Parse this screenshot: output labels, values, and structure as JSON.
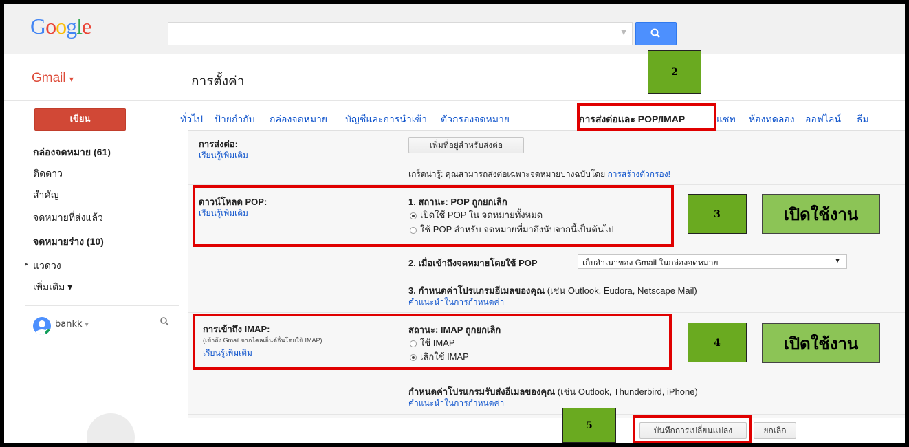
{
  "header": {
    "logo": "Google",
    "search_placeholder": "",
    "search_button_icon": "search-icon"
  },
  "app": {
    "name": "Gmail",
    "menu_caret": "▾",
    "page_title": "การตั้งค่า"
  },
  "sidebar": {
    "compose": "เขียน",
    "items": [
      {
        "label": "กล่องจดหมาย (61)",
        "bold": true
      },
      {
        "label": "ติดดาว",
        "bold": false
      },
      {
        "label": "สำคัญ",
        "bold": false
      },
      {
        "label": "จดหมายที่ส่งแล้ว",
        "bold": false
      },
      {
        "label": "จดหมายร่าง (10)",
        "bold": true
      },
      {
        "label": "แวดวง",
        "bold": false
      },
      {
        "label": "เพิ่มเติม ▾",
        "bold": false
      }
    ],
    "circles_arrow": "▸",
    "user": "bankk",
    "user_caret": "▾"
  },
  "tabs": [
    {
      "label": "ทั่วไป"
    },
    {
      "label": "ป้ายกำกับ"
    },
    {
      "label": "กล่องจดหมาย"
    },
    {
      "label": "บัญชีและการนำเข้า"
    },
    {
      "label": "ตัวกรองจดหมาย"
    },
    {
      "label": "การส่งต่อและ POP/IMAP",
      "active": true
    },
    {
      "label": "แชท"
    },
    {
      "label": "ห้องทดลอง"
    },
    {
      "label": "ออฟไลน์"
    },
    {
      "label": "ธีม"
    }
  ],
  "forwarding": {
    "label": "การส่งต่อ:",
    "learn_more": "เรียนรู้เพิ่มเติม",
    "add_button": "เพิ่มที่อยู่สำหรับส่งต่อ",
    "tip_prefix": "เกร็ดน่ารู้: คุณสามารถส่งต่อเฉพาะจดหมายบางฉบับโดย ",
    "tip_link": "การสร้างตัวกรอง!"
  },
  "pop": {
    "label": "ดาวน์โหลด POP:",
    "learn_more": "เรียนรู้เพิ่มเติม",
    "status": "1. สถานะ: POP ถูกยกเลิก",
    "option1": "เปิดใช้ POP ใน จดหมายทั้งหมด",
    "option2": "ใช้ POP สำหรับ จดหมายที่มาถึงนับจากนี้เป็นต้นไป",
    "when_access": "2. เมื่อเข้าถึงจดหมายโดยใช้ POP",
    "when_value": "เก็บสำเนาของ Gmail ในกล่องจดหมาย",
    "configure": "3. กำหนดค่าโปรแกรมอีเมลของคุณ",
    "configure_hint": " (เช่น Outlook, Eudora, Netscape Mail)",
    "config_link": "คำแนะนำในการกำหนดค่า"
  },
  "imap": {
    "label": "การเข้าถึง IMAP:",
    "sublabel": "(เข้าถึง Gmail จากไคลเอ็นต์อื่นโดยใช้ IMAP)",
    "learn_more": "เรียนรู้เพิ่มเติม",
    "status": "สถานะ: IMAP ถูกยกเลิก",
    "option1": "ใช้ IMAP",
    "option2": "เลิกใช้ IMAP",
    "configure": "กำหนดค่าโปรแกรมรับส่งอีเมลของคุณ",
    "configure_hint": " (เช่น Outlook, Thunderbird, iPhone)",
    "config_link": "คำแนะนำในการกำหนดค่า"
  },
  "footer": {
    "save": "บันทึกการเปลี่ยนแปลง",
    "cancel": "ยกเลิก"
  },
  "annotations": {
    "step2": "2",
    "step3": "3",
    "step4": "4",
    "step5": "5",
    "enable1": "เปิดใช้งาน",
    "enable2": "เปิดใช้งาน"
  }
}
